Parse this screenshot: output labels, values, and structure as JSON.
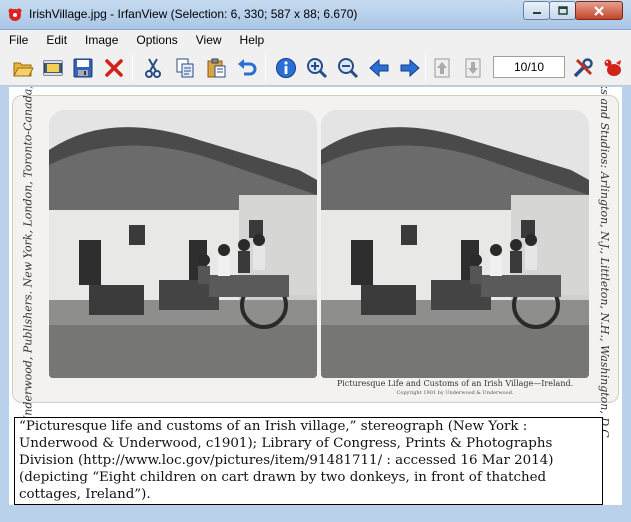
{
  "window": {
    "title": "IrfanView (Selection: 6, 330; 587 x 88; 6.670)",
    "filename": "IrishVillage.jpg",
    "separator": " - "
  },
  "menu": [
    "File",
    "Edit",
    "Image",
    "Options",
    "View",
    "Help"
  ],
  "toolbar": {
    "icons": [
      "open-icon",
      "slideshow-icon",
      "save-icon",
      "delete-icon",
      "cut-icon",
      "copy-icon",
      "paste-icon",
      "undo-icon",
      "info-icon",
      "zoom-in-icon",
      "zoom-out-icon",
      "previous-icon",
      "next-icon",
      "page-up-icon",
      "page-down-icon",
      "settings-icon",
      "irfanview-logo-icon"
    ],
    "page_counter": "10/10"
  },
  "image": {
    "card_left_text": "Underwood & Underwood, Publishers. New York, London, Toronto-Canada, Ottawa-Kansas.",
    "card_right_text": "Works and Studios: Arlington, N.J., Littleton, N.H., Washington, D.C.",
    "card_caption": "Picturesque Life and Customs of an Irish Village—Ireland.",
    "card_copyright": "Copyright 1901 by Underwood & Underwood.",
    "caption_text": "“Picturesque life and customs of an Irish village,” stereograph (New York : Underwood & Underwood, c1901); Library of Congress, Prints & Photographs Division (http://www.loc.gov/pictures/item/91481711/ : accessed 16 Mar 2014) (depicting “Eight children on cart drawn by two donkeys, in front of thatched cottages, Ireland”)."
  },
  "colors": {
    "accent_blue": "#2a6fd6",
    "delete_red": "#d2231a",
    "titlebar": "#b9d1ea"
  }
}
